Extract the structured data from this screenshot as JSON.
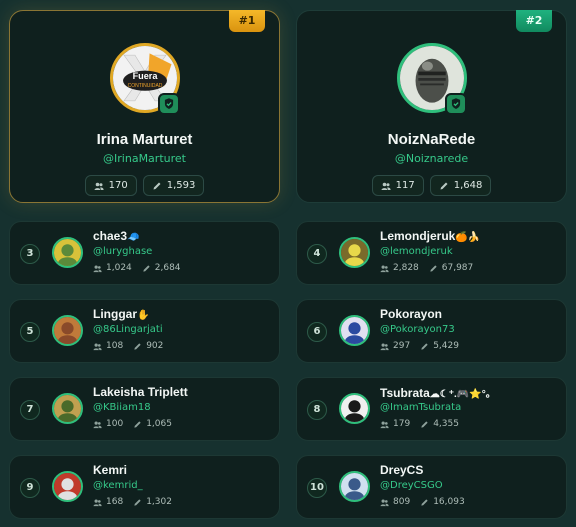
{
  "top": [
    {
      "rank": "#1",
      "name": "Irina Marturet",
      "handle": "@IrinaMarturet",
      "followers": "170",
      "posts": "1,593"
    },
    {
      "rank": "#2",
      "name": "NoizNaRede",
      "handle": "@Noiznarede",
      "followers": "117",
      "posts": "1,648"
    }
  ],
  "avatar_text": {
    "logo_line1": "Fuera",
    "logo_line2": "CONTINUIDAD"
  },
  "list": [
    {
      "rank": "3",
      "name": "chae3",
      "emoji": "🧢",
      "handle": "@luryghase",
      "followers": "1,024",
      "posts": "2,684"
    },
    {
      "rank": "4",
      "name": "Lemondjeruk",
      "emoji": "🍊🍌",
      "handle": "@lemondjeruk",
      "followers": "2,828",
      "posts": "67,987"
    },
    {
      "rank": "5",
      "name": "Linggar",
      "emoji": "✋",
      "handle": "@86Lingarjati",
      "followers": "108",
      "posts": "902"
    },
    {
      "rank": "6",
      "name": "Pokorayon",
      "emoji": "",
      "handle": "@Pokorayon73",
      "followers": "297",
      "posts": "5,429"
    },
    {
      "rank": "7",
      "name": "Lakeisha Triplett",
      "emoji": "",
      "handle": "@KBiiam18",
      "followers": "100",
      "posts": "1,065"
    },
    {
      "rank": "8",
      "name": "Tsubrata",
      "emoji": "☁☾⁺.🎮⭐°｡",
      "handle": "@ImamTsubrata",
      "followers": "179",
      "posts": "4,355"
    },
    {
      "rank": "9",
      "name": "Kemri",
      "emoji": "",
      "handle": "@kemrid_",
      "followers": "168",
      "posts": "1,302"
    },
    {
      "rank": "10",
      "name": "DreyCS",
      "emoji": "",
      "handle": "@DreyCSGO",
      "followers": "809",
      "posts": "16,093"
    }
  ],
  "colors": {
    "accent": "#36c98a",
    "gold": "#e0a824",
    "card_bg": "#0f201e",
    "page_bg": "#16312f"
  }
}
